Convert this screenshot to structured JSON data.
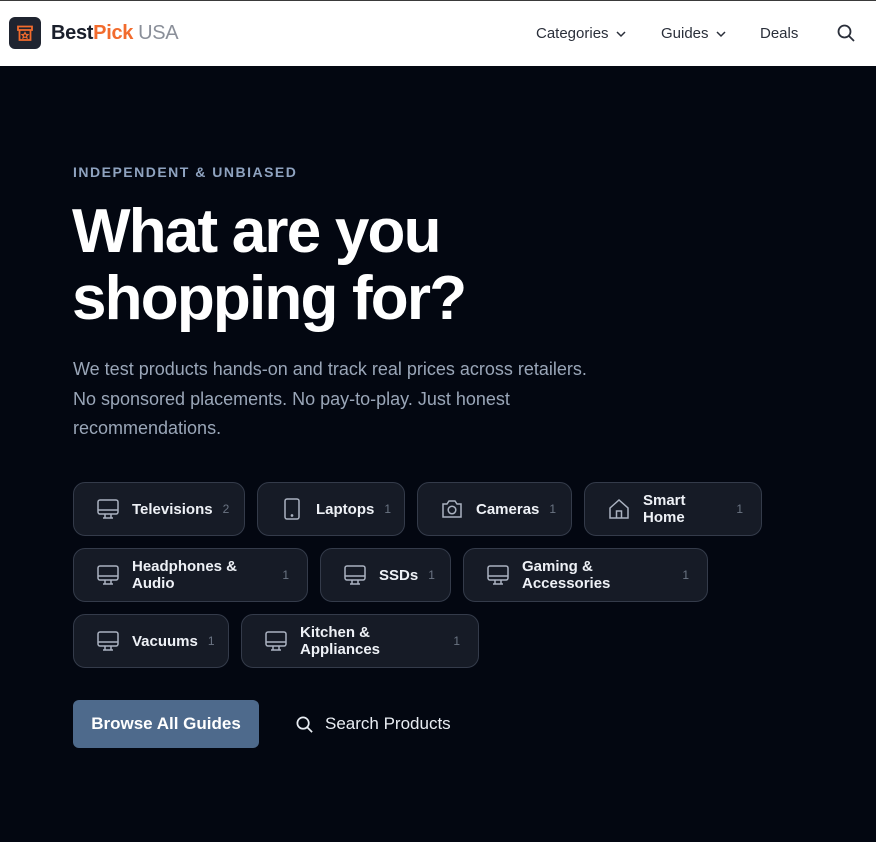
{
  "header": {
    "brand": {
      "part1": "Best",
      "part2": "Pick",
      "part3": "USA"
    },
    "nav": [
      {
        "label": "Categories",
        "icon": "chevron-down-icon"
      },
      {
        "label": "Guides",
        "icon": "chevron-down-icon"
      },
      {
        "label": "Deals"
      }
    ],
    "search_icon": "search-icon"
  },
  "hero": {
    "eyebrow": "INDEPENDENT & UNBIASED",
    "headline_line1": "What are you",
    "headline_line2": "shopping for?",
    "lead_line1": "We test products hands-on and track real prices across retailers.",
    "lead_line2": "No sponsored placements. No pay-to-play. Just honest",
    "lead_line3": "recommendations."
  },
  "categories": [
    {
      "label": "Televisions",
      "count": "2",
      "icon": "monitor-icon"
    },
    {
      "label": "Laptops",
      "count": "1",
      "icon": "tablet-icon"
    },
    {
      "label": "Cameras",
      "count": "1",
      "icon": "camera-icon"
    },
    {
      "label": "Smart Home",
      "count": "1",
      "icon": "home-icon"
    },
    {
      "label": "Headphones & Audio",
      "count": "1",
      "icon": "monitor-icon"
    },
    {
      "label": "SSDs",
      "count": "1",
      "icon": "monitor-icon"
    },
    {
      "label": "Gaming & Accessories",
      "count": "1",
      "icon": "monitor-icon"
    },
    {
      "label": "Vacuums",
      "count": "1",
      "icon": "monitor-icon"
    },
    {
      "label": "Kitchen & Appliances",
      "count": "1",
      "icon": "monitor-icon"
    }
  ],
  "actions": {
    "primary_label": "Browse All Guides",
    "secondary_label": "Search Products"
  },
  "colors": {
    "background": "#030711",
    "accent_orange": "#f26b2d",
    "primary_button": "#4e6a8c",
    "chip_background": "#161b26"
  }
}
